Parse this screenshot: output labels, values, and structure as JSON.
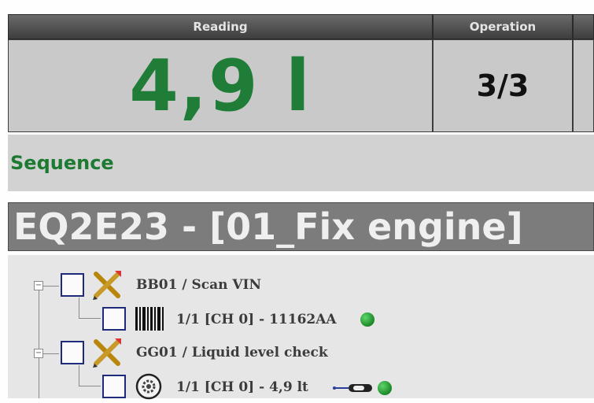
{
  "header": {
    "reading_label": "Reading",
    "operation_label": "Operation",
    "reading_value": "4,9 l",
    "operation_value": "3/3"
  },
  "sequence": {
    "label": "Sequence",
    "title": "EQ2E23 - [01_Fix engine]"
  },
  "tree": {
    "items": [
      {
        "code": "BB01 / Scan VIN",
        "sub": "1/1 [CH 0] - 11162AA",
        "icon": "barcode-icon",
        "status": "ok"
      },
      {
        "code": "GG01 / Liquid level check",
        "sub": "1/1 [CH 0] - 4,9 lt",
        "icon": "gear-icon",
        "status": "ok"
      }
    ]
  },
  "colors": {
    "reading_green": "#1f7d37",
    "sequence_green": "#1e7a33",
    "checkbox_border": "#1f2a7a",
    "status_ok": "#1f8d2b"
  }
}
